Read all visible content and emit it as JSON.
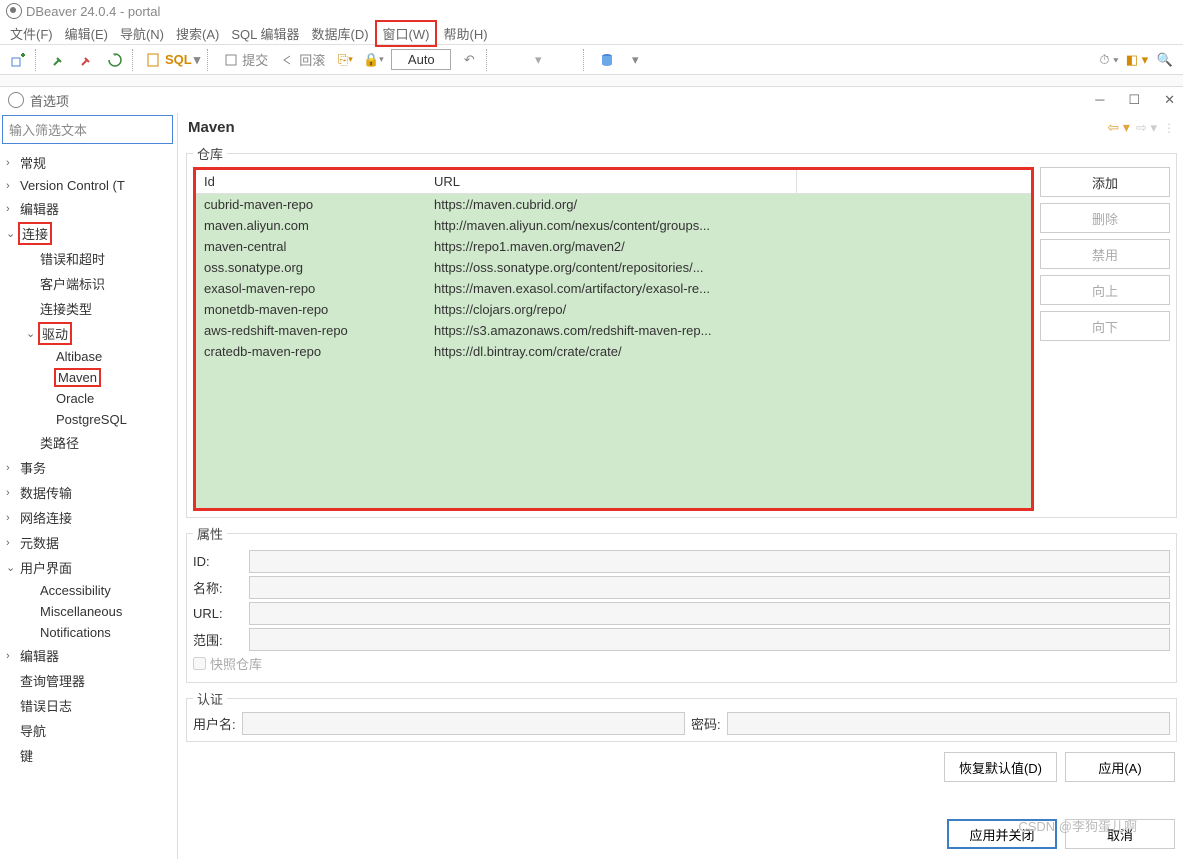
{
  "title": "DBeaver 24.0.4 -             portal",
  "menu": [
    "文件(F)",
    "编辑(E)",
    "导航(N)",
    "搜索(A)",
    "SQL 编辑器",
    "数据库(D)",
    "窗口(W)",
    "帮助(H)"
  ],
  "menu_highlight_index": 6,
  "toolbar": {
    "sql": "SQL",
    "commit": "提交",
    "rollback": "回滚",
    "auto": "Auto"
  },
  "prefs": {
    "title": "首选项",
    "filter_placeholder": "输入筛选文本",
    "tree": [
      {
        "label": "常规",
        "lvl": 0,
        "exp": ">"
      },
      {
        "label": "Version Control (T",
        "lvl": 0,
        "exp": ">"
      },
      {
        "label": "编辑器",
        "lvl": 0,
        "exp": ">"
      },
      {
        "label": "连接",
        "lvl": 0,
        "exp": "v",
        "hl": true
      },
      {
        "label": "错误和超时",
        "lvl": 1
      },
      {
        "label": "客户端标识",
        "lvl": 1
      },
      {
        "label": "连接类型",
        "lvl": 1
      },
      {
        "label": "驱动",
        "lvl": 1,
        "exp": "v",
        "hl": true
      },
      {
        "label": "Altibase",
        "lvl": 2
      },
      {
        "label": "Maven",
        "lvl": 2,
        "hl": true
      },
      {
        "label": "Oracle",
        "lvl": 2
      },
      {
        "label": "PostgreSQL",
        "lvl": 2
      },
      {
        "label": "类路径",
        "lvl": 1
      },
      {
        "label": "事务",
        "lvl": 0,
        "exp": ">"
      },
      {
        "label": "数据传输",
        "lvl": 0,
        "exp": ">"
      },
      {
        "label": "网络连接",
        "lvl": 0,
        "exp": ">"
      },
      {
        "label": "元数据",
        "lvl": 0,
        "exp": ">"
      },
      {
        "label": "用户界面",
        "lvl": 0,
        "exp": "v"
      },
      {
        "label": "Accessibility",
        "lvl": 1
      },
      {
        "label": "Miscellaneous",
        "lvl": 1
      },
      {
        "label": "Notifications",
        "lvl": 1
      },
      {
        "label": "编辑器",
        "lvl": 0,
        "exp": ">"
      },
      {
        "label": "查询管理器",
        "lvl": 0
      },
      {
        "label": "错误日志",
        "lvl": 0
      },
      {
        "label": "导航",
        "lvl": 0
      },
      {
        "label": "键",
        "lvl": 0
      }
    ],
    "page_title": "Maven",
    "repos_legend": "仓库",
    "cols": {
      "id": "Id",
      "url": "URL"
    },
    "repos": [
      {
        "id": "cubrid-maven-repo",
        "url": "https://maven.cubrid.org/"
      },
      {
        "id": "maven.aliyun.com",
        "url": "http://maven.aliyun.com/nexus/content/groups..."
      },
      {
        "id": "maven-central",
        "url": "https://repo1.maven.org/maven2/"
      },
      {
        "id": "oss.sonatype.org",
        "url": "https://oss.sonatype.org/content/repositories/..."
      },
      {
        "id": "exasol-maven-repo",
        "url": "https://maven.exasol.com/artifactory/exasol-re..."
      },
      {
        "id": "monetdb-maven-repo",
        "url": "https://clojars.org/repo/"
      },
      {
        "id": "aws-redshift-maven-repo",
        "url": "https://s3.amazonaws.com/redshift-maven-rep..."
      },
      {
        "id": "cratedb-maven-repo",
        "url": "https://dl.bintray.com/crate/crate/"
      }
    ],
    "buttons": {
      "add": "添加",
      "remove": "删除",
      "disable": "禁用",
      "up": "向上",
      "down": "向下"
    },
    "props_legend": "属性",
    "props": {
      "id": "ID:",
      "name": "名称:",
      "url": "URL:",
      "scope": "范围:",
      "snapshot": "快照仓库"
    },
    "auth_legend": "认证",
    "auth": {
      "user": "用户名:",
      "pwd": "密码:"
    },
    "footer": {
      "restore": "恢复默认值(D)",
      "apply": "应用(A)",
      "apply_close": "应用并关闭",
      "cancel": "取消"
    },
    "watermark": "CSDN @李狗蛋儿啊"
  }
}
